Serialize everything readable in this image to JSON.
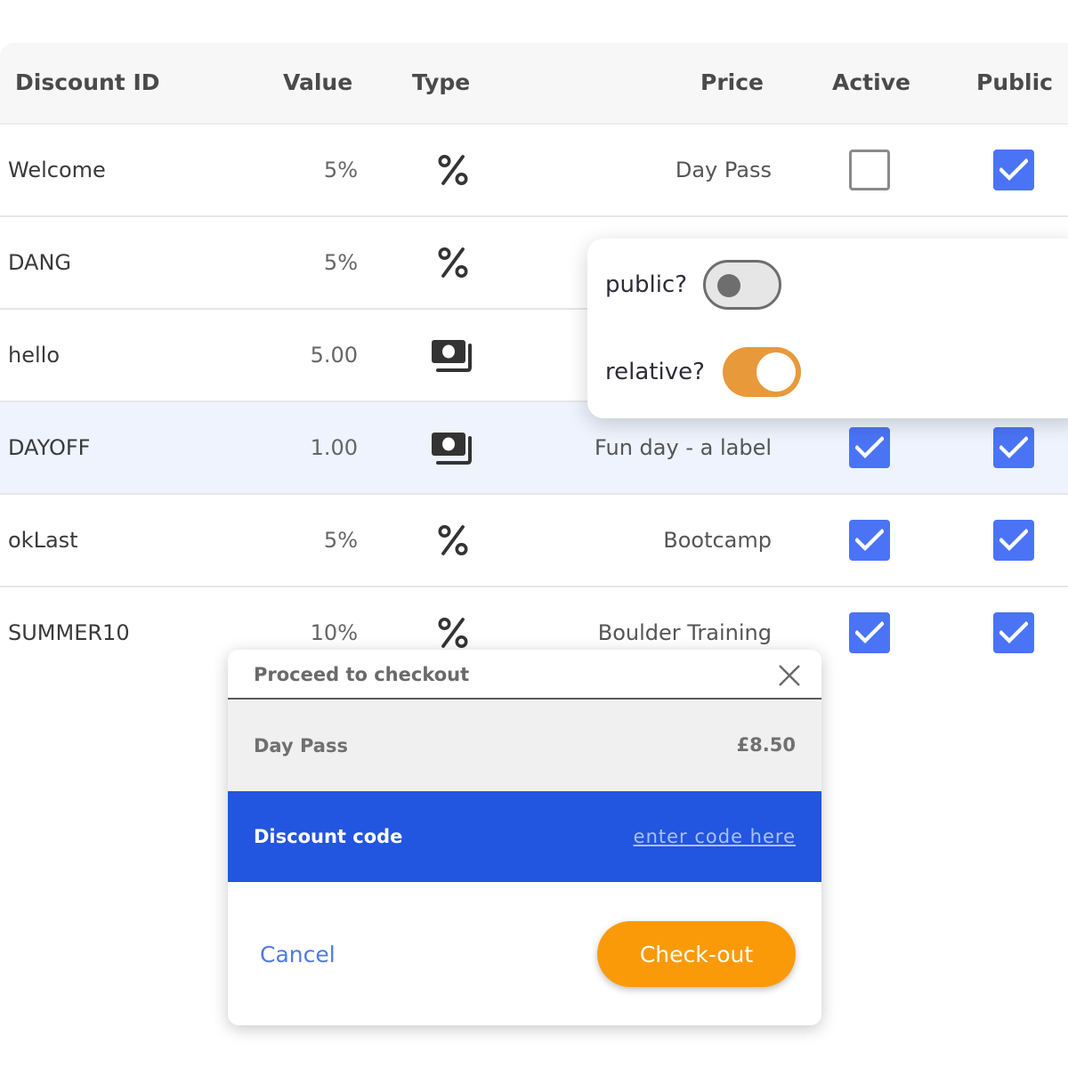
{
  "table": {
    "headers": {
      "id": "Discount ID",
      "value": "Value",
      "type": "Type",
      "price": "Price",
      "active": "Active",
      "public": "Public"
    },
    "rows": [
      {
        "id": "Welcome",
        "value": "5%",
        "type": "percent-icon",
        "price": "Day Pass",
        "active": false,
        "public": true
      },
      {
        "id": "DANG",
        "value": "5%",
        "type": "percent-icon",
        "price": "",
        "active": null,
        "public": null
      },
      {
        "id": "hello",
        "value": "5.00",
        "type": "money-icon",
        "price": "",
        "active": null,
        "public": null
      },
      {
        "id": "DAYOFF",
        "value": "1.00",
        "type": "money-icon",
        "price": "Fun day - a label",
        "active": true,
        "public": true
      },
      {
        "id": "okLast",
        "value": "5%",
        "type": "percent-icon",
        "price": "Bootcamp",
        "active": true,
        "public": true
      },
      {
        "id": "SUMMER10",
        "value": "10%",
        "type": "percent-icon",
        "price": "Boulder Training",
        "active": true,
        "public": true
      }
    ]
  },
  "toggles": {
    "public": {
      "label": "public?",
      "on": false
    },
    "relative": {
      "label": "relative?",
      "on": true,
      "color": "#e8993a"
    }
  },
  "checkout": {
    "title": "Proceed to checkout",
    "item_name": "Day Pass",
    "item_price": "£8.50",
    "discount_label": "Discount code",
    "discount_placeholder": "enter code here",
    "cancel_label": "Cancel",
    "checkout_label": "Check-out",
    "accent": "#2255e0",
    "button_color": "#fb9a08"
  }
}
